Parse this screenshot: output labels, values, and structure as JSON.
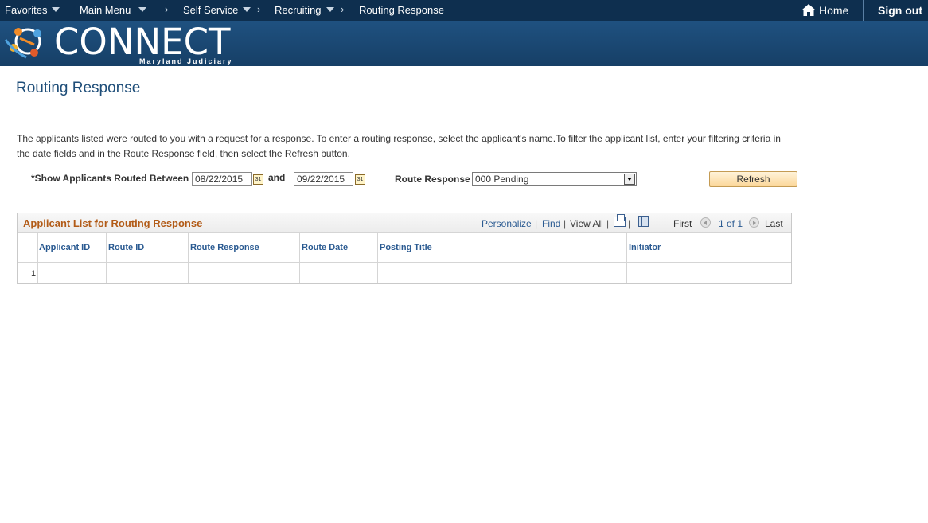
{
  "topnav": {
    "favorites": "Favorites",
    "main_menu": "Main Menu",
    "breadcrumb": [
      "Self Service",
      "Recruiting",
      "Routing Response"
    ],
    "home": "Home",
    "signout": "Sign out"
  },
  "banner": {
    "logo_text": "CONNECT",
    "logo_subtitle": "Maryland Judiciary"
  },
  "page": {
    "title": "Routing Response",
    "instructions": "The applicants listed were routed to you with a request for a response. To enter a routing response, select the applicant's name.To filter the applicant list, enter your filtering criteria in the date fields and in the Route Response field, then select the Refresh button."
  },
  "filters": {
    "date_label": "*Show Applicants Routed Between",
    "from_date": "08/22/2015",
    "and_label": "and",
    "to_date": "09/22/2015",
    "route_response_label": "Route Response",
    "route_response_value": "000 Pending",
    "refresh_label": "Refresh",
    "calendar_glyph": "31"
  },
  "grid": {
    "title": "Applicant List for Routing Response",
    "personalize": "Personalize",
    "find": "Find",
    "view_all": "View All",
    "first": "First",
    "page_info": "1 of 1",
    "last": "Last",
    "columns": [
      "Applicant ID",
      "Route ID",
      "Route Response",
      "Route Date",
      "Posting Title",
      "Initiator"
    ],
    "rows": [
      {
        "num": "1",
        "cells": [
          "",
          "",
          "",
          "",
          "",
          ""
        ]
      }
    ]
  },
  "colors": {
    "nav_bg": "#0e2f4f",
    "banner_bg": "#1f5180",
    "title": "#1f4e79",
    "grid_title": "#b25b17",
    "link": "#2a5a91",
    "button_bg": "#fbd79a"
  }
}
